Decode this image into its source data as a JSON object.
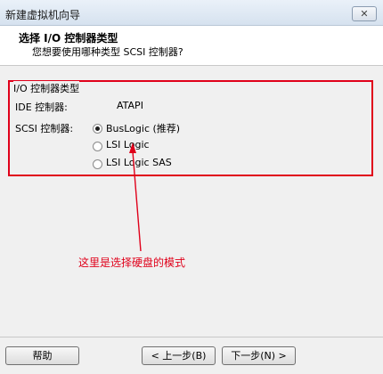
{
  "window": {
    "title": "新建虚拟机向导",
    "close_glyph": "✕"
  },
  "header": {
    "title": "选择 I/O 控制器类型",
    "subtitle": "您想要使用哪种类型 SCSI 控制器?"
  },
  "group": {
    "title": "I/O 控制器类型",
    "ide_label": "IDE 控制器:",
    "ide_value": "ATAPI",
    "scsi_label": "SCSI 控制器:",
    "options": [
      {
        "label": "BusLogic (推荐)",
        "selected": true
      },
      {
        "label": "LSI Logic",
        "selected": false
      },
      {
        "label": "LSI Logic SAS",
        "selected": false
      }
    ]
  },
  "annotation": {
    "text": "这里是选择硬盘的模式",
    "color": "#e0001a"
  },
  "footer": {
    "help_label": "帮助",
    "back_label": "< 上一步(B)",
    "next_label": "下一步(N) >"
  }
}
